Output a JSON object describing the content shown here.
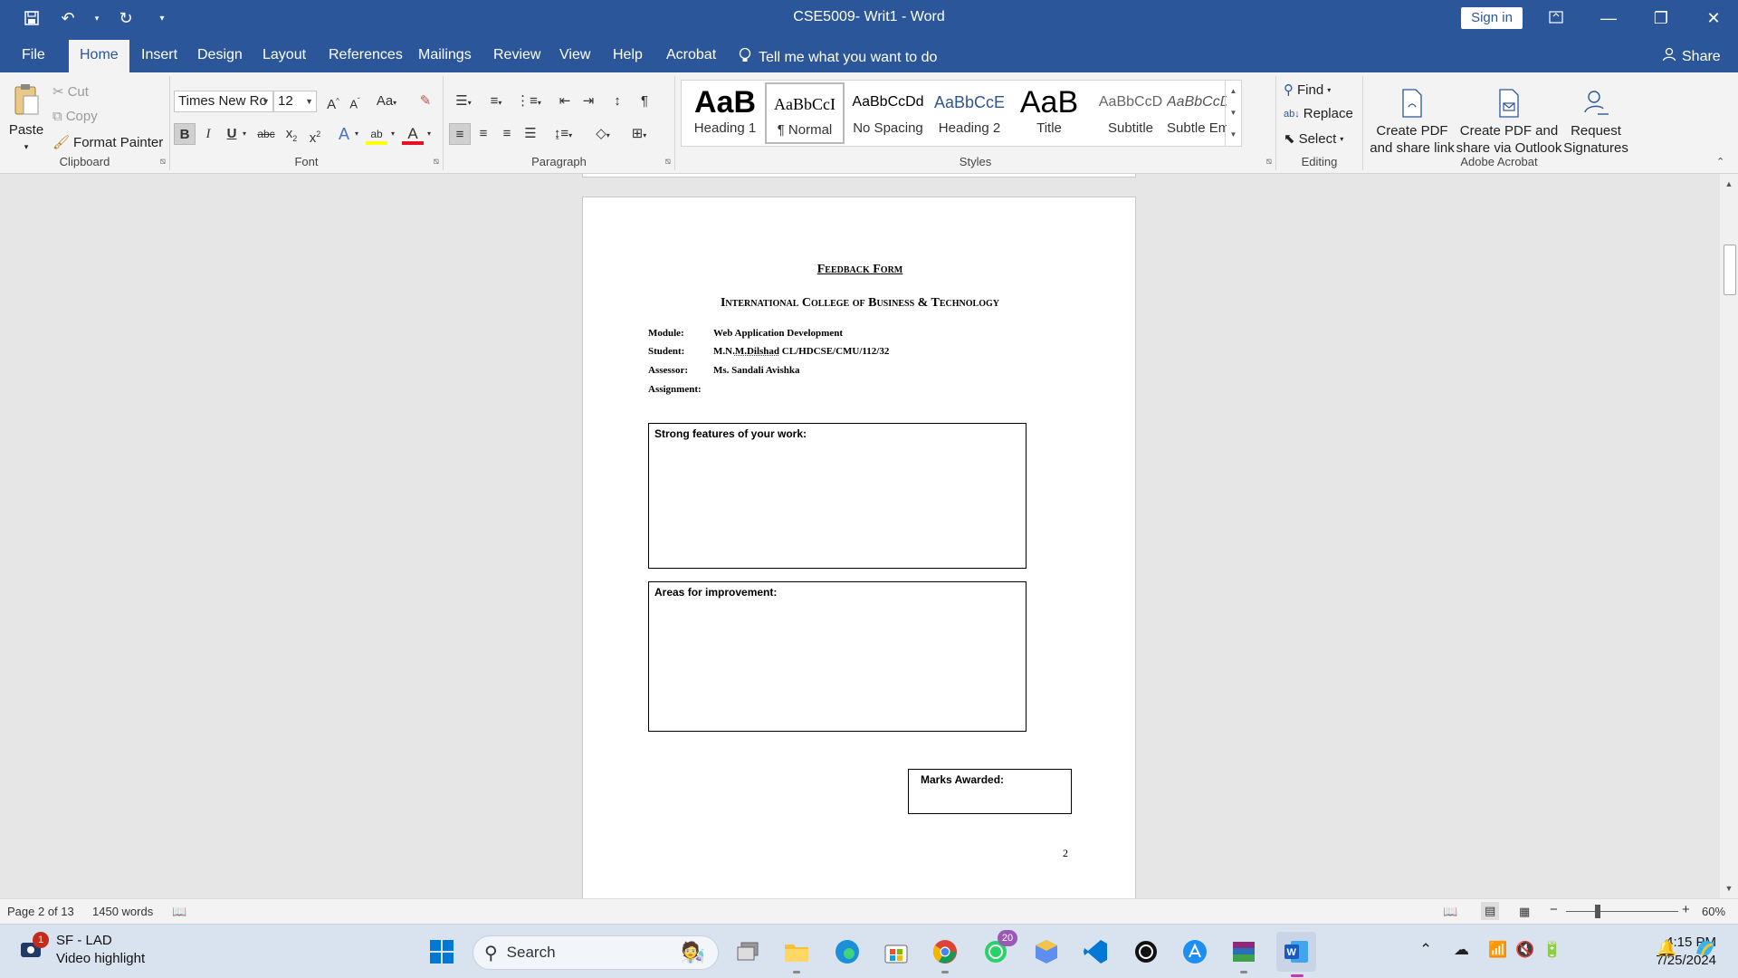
{
  "window": {
    "title": "CSE5009- Writ1  -  Word",
    "sign_in": "Sign in",
    "qat": {
      "save_icon": "save-icon",
      "undo_icon": "undo-icon",
      "redo_icon": "redo-icon",
      "customize_icon": "customize-qat-icon"
    }
  },
  "tabs": [
    {
      "label": "File"
    },
    {
      "label": "Home"
    },
    {
      "label": "Insert"
    },
    {
      "label": "Design"
    },
    {
      "label": "Layout"
    },
    {
      "label": "References"
    },
    {
      "label": "Mailings"
    },
    {
      "label": "Review"
    },
    {
      "label": "View"
    },
    {
      "label": "Help"
    },
    {
      "label": "Acrobat"
    }
  ],
  "active_tab": "Home",
  "tell_me": "Tell me what you want to do",
  "share": "Share",
  "ribbon": {
    "clipboard": {
      "label": "Clipboard",
      "paste": "Paste",
      "cut": "Cut",
      "copy": "Copy",
      "format_painter": "Format Painter"
    },
    "font": {
      "label": "Font",
      "font_name": "Times New Ro",
      "font_size": "12",
      "change_case": "Aa"
    },
    "paragraph": {
      "label": "Paragraph"
    },
    "styles": {
      "label": "Styles",
      "items": [
        {
          "preview": "AaB",
          "name": "Heading 1"
        },
        {
          "preview": "AaBbCcI",
          "name": "¶ Normal"
        },
        {
          "preview": "AaBbCcDd",
          "name": "No Spacing"
        },
        {
          "preview": "AaBbCcE",
          "name": "Heading 2"
        },
        {
          "preview": "AaB",
          "name": "Title"
        },
        {
          "preview": "AaBbCcD",
          "name": "Subtitle"
        },
        {
          "preview": "AaBbCcDi",
          "name": "Subtle Em..."
        }
      ],
      "selected": "¶ Normal"
    },
    "editing": {
      "label": "Editing",
      "find": "Find",
      "replace": "Replace",
      "select": "Select"
    },
    "acrobat": {
      "label": "Adobe Acrobat",
      "create_pdf_link": "Create PDF and share link",
      "create_pdf_outlook": "Create PDF and share via Outlook",
      "request_signatures": "Request Signatures"
    }
  },
  "document": {
    "form_title": "Feedback Form",
    "college": "International College of Business & Technology",
    "module_label": "Module:",
    "module_value": "Web Application Development",
    "student_label": "Student:",
    "student_value_a": "M.N.",
    "student_value_b": "M.Dilshad",
    "student_value_c": " CL/HDCSE/CMU/112/32",
    "assessor_label": "Assessor:",
    "assessor_value": "Ms. Sandali Avishka",
    "assignment_label": "Assignment:",
    "strong_features": "Strong features of your work:",
    "improvement": "Areas for improvement:",
    "marks_awarded": "Marks Awarded:",
    "page_number": "2"
  },
  "status": {
    "page": "Page 2 of 13",
    "words": "1450 words",
    "zoom": "60%"
  },
  "taskbar": {
    "notification_title": "SF - LAD",
    "notification_sub": "Video highlight",
    "notification_count": "1",
    "search_placeholder": "Search",
    "whatsapp_badge": "20",
    "time": "4:15 PM",
    "date": "7/25/2024"
  },
  "colors": {
    "word_blue": "#2b579a",
    "ribbon_bg": "#f3f3f3",
    "page_bg": "#ffffff",
    "canvas_bg": "#e6e6e6"
  }
}
